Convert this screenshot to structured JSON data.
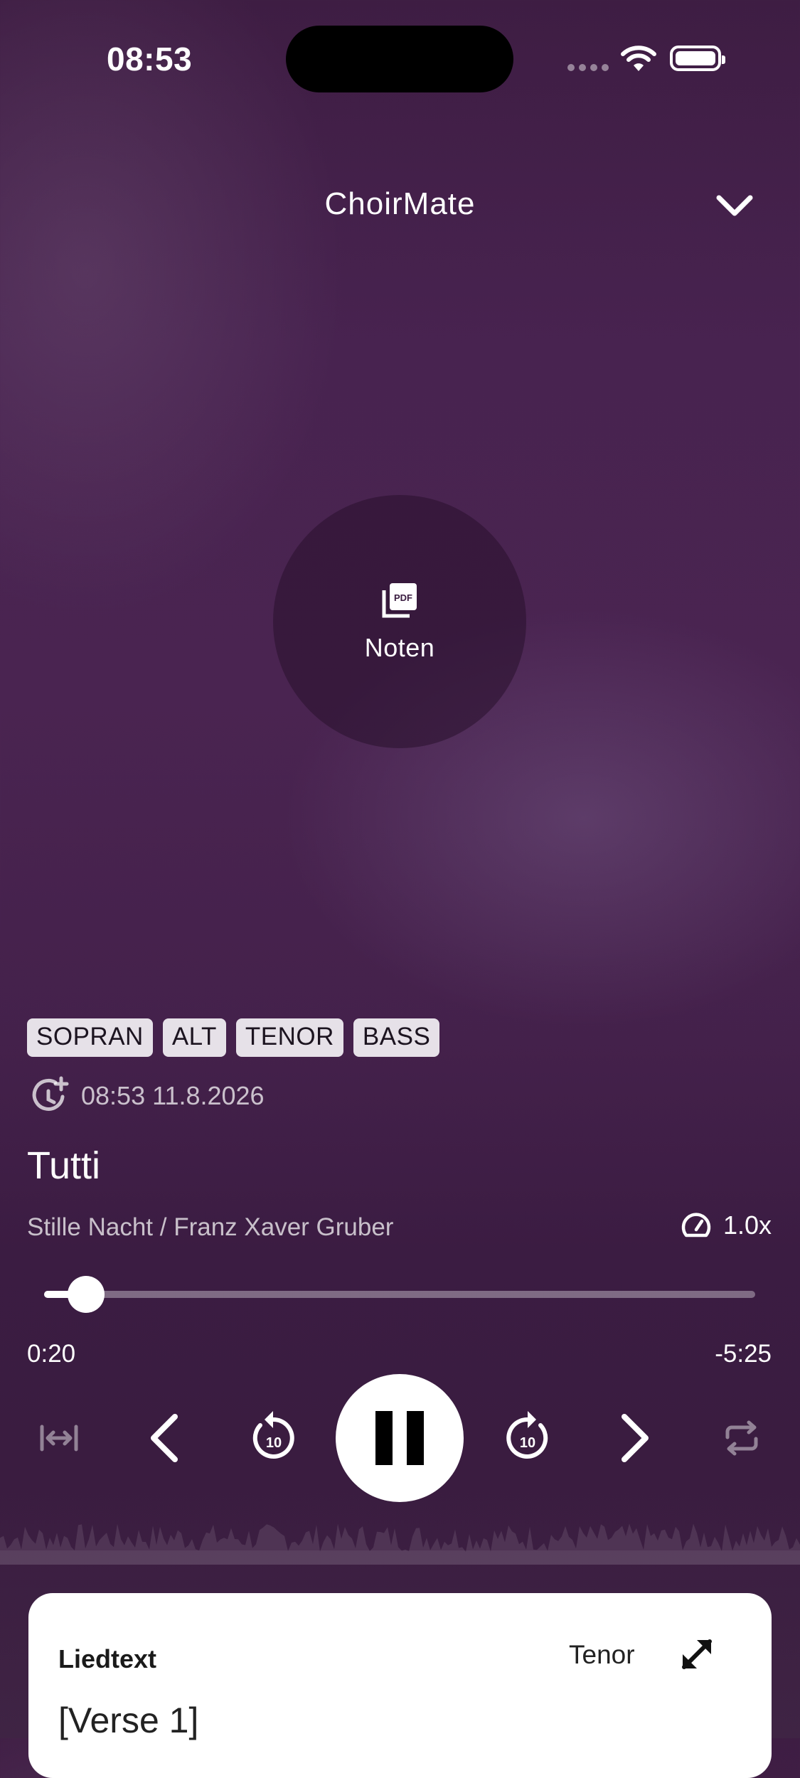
{
  "status_bar": {
    "time": "08:53"
  },
  "header": {
    "title": "ChoirMate",
    "collapse_icon": "chevron-down-icon"
  },
  "sheet_music": {
    "label": "Noten",
    "icon": "pdf-icon"
  },
  "voices": [
    "SOPRAN",
    "ALT",
    "TENOR",
    "BASS"
  ],
  "recording": {
    "timestamp": "08:53 11.8.2026",
    "icon": "history-add-icon"
  },
  "track": {
    "title": "Tutti",
    "subtitle": "Stille Nacht / Franz Xaver Gruber"
  },
  "playback": {
    "speed": "1.0x",
    "elapsed": "0:20",
    "remaining": "-5:25",
    "progress": 0.059,
    "state": "playing"
  },
  "controls": {
    "fit_icon": "fit-width-icon",
    "previous_icon": "chevron-left-icon",
    "rewind_icon": "replay-10-icon",
    "rewind_seconds": "10",
    "pause_icon": "pause-icon",
    "forward_icon": "forward-10-icon",
    "forward_seconds": "10",
    "next_icon": "chevron-right-icon",
    "repeat_icon": "repeat-icon"
  },
  "lyrics": {
    "title": "Liedtext",
    "voice": "Tenor",
    "first_line": "[Verse 1]"
  },
  "colors": {
    "background": "#4a2451",
    "chip": "#e6e1e8",
    "card": "#ffffff"
  }
}
